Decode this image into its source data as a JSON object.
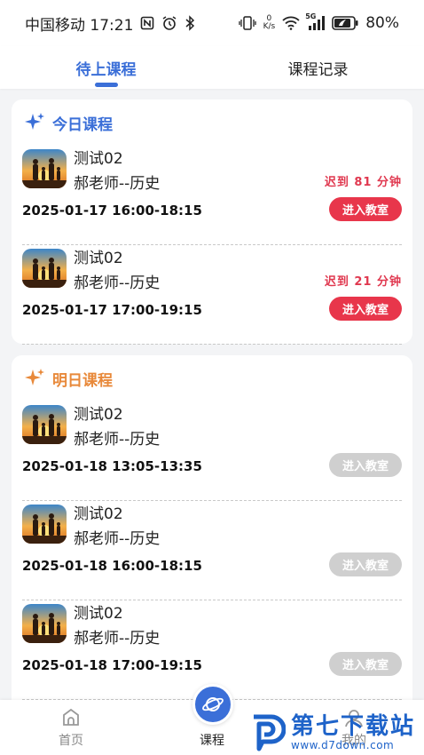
{
  "status_bar": {
    "carrier_time": "中国移动 17:21",
    "net_speed_top": "0",
    "net_speed_unit": "K/s",
    "signal_label": "5G",
    "battery": "80%"
  },
  "tabs": [
    {
      "label": "待上课程",
      "active": true
    },
    {
      "label": "课程记录",
      "active": false
    }
  ],
  "today": {
    "title": "今日课程",
    "courses": [
      {
        "name": "测试02",
        "teacher": "郝老师--历史",
        "time": "2025-01-17 16:00-18:15",
        "late": "迟到 81 分钟",
        "button": "进入教室"
      },
      {
        "name": "测试02",
        "teacher": "郝老师--历史",
        "time": "2025-01-17 17:00-19:15",
        "late": "迟到 21 分钟",
        "button": "进入教室"
      }
    ]
  },
  "tomorrow": {
    "title": "明日课程",
    "courses": [
      {
        "name": "测试02",
        "teacher": "郝老师--历史",
        "time": "2025-01-18 13:05-13:35",
        "button": "进入教室"
      },
      {
        "name": "测试02",
        "teacher": "郝老师--历史",
        "time": "2025-01-18 16:00-18:15",
        "button": "进入教室"
      },
      {
        "name": "测试02",
        "teacher": "郝老师--历史",
        "time": "2025-01-18 17:00-19:15",
        "button": "进入教室"
      }
    ]
  },
  "bottom_nav": {
    "home": "首页",
    "course": "课程",
    "mine": "我的"
  },
  "watermark": {
    "title": "第七下载站",
    "url": "www.d7down.com"
  },
  "colors": {
    "primary": "#3b6fd8",
    "late_red": "#e0384f",
    "tomorrow_orange": "#e8893a",
    "disabled_gray": "#cfcfcf"
  }
}
